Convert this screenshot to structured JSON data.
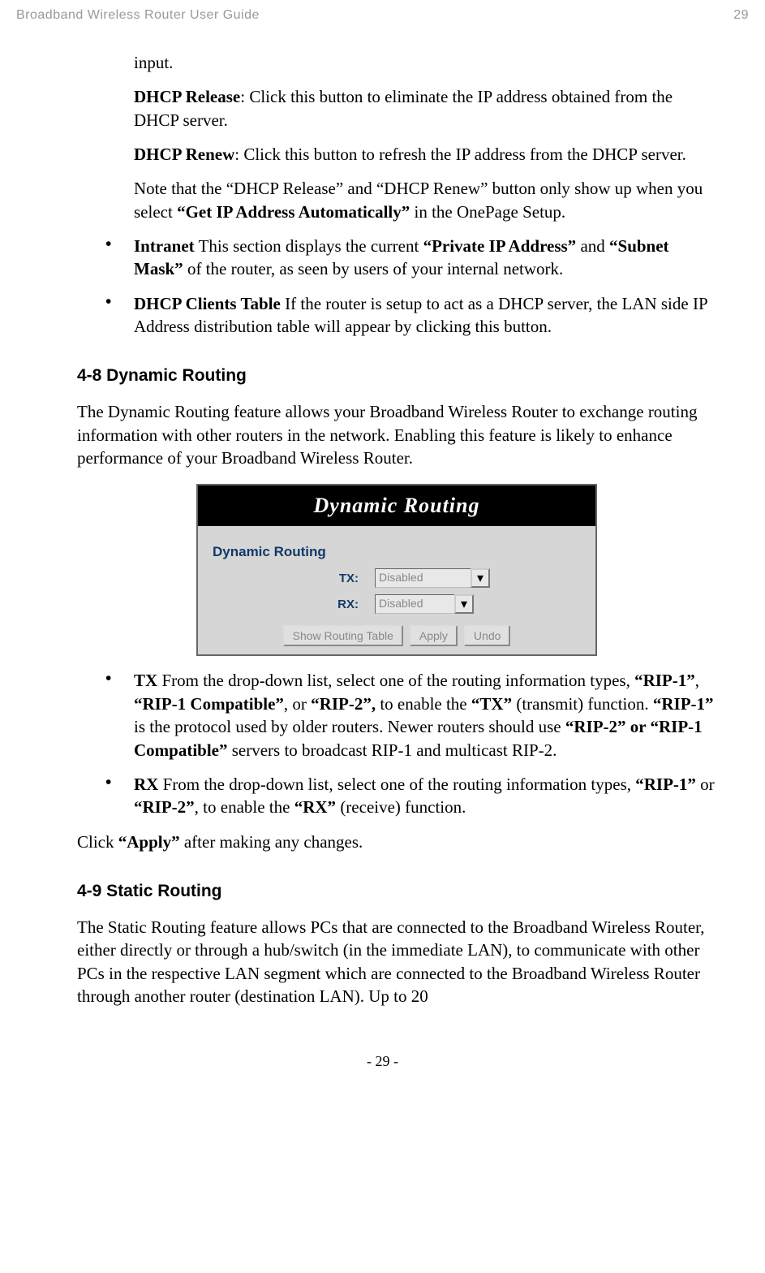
{
  "header": {
    "title": "Broadband Wireless Router User Guide",
    "page_number": "29"
  },
  "body": {
    "input_trail": "input.",
    "dhcp_release_label": "DHCP Release",
    "dhcp_release_text": ": Click this button to eliminate the IP address obtained from the DHCP server.",
    "dhcp_renew_label": "DHCP Renew",
    "dhcp_renew_text": ": Click this button to refresh the IP address from the DHCP server.",
    "note_pre": "Note that the “DHCP Release” and “DHCP Renew” button only show up when you select ",
    "note_bold": "“Get IP Address Automatically”",
    "note_post": " in the OnePage Setup.",
    "intranet_label": "Intranet",
    "intranet_text_pre": " This section displays the current ",
    "intranet_bold1": "“Private IP Address”",
    "intranet_mid": " and ",
    "intranet_bold2": "“Subnet Mask”",
    "intranet_post": " of the router, as seen by users of your internal network.",
    "dhcp_clients_label": "DHCP Clients Table",
    "dhcp_clients_text": " If the router is setup to act as a DHCP server, the LAN side IP Address distribution table will appear by clicking this button.",
    "sec48_heading": "4-8 Dynamic Routing",
    "sec48_intro": "The Dynamic Routing feature allows your Broadband Wireless Router to exchange routing information with other routers in the network. Enabling this feature is likely to enhance performance of your Broadband Wireless Router.",
    "figure": {
      "title": "Dynamic Routing",
      "heading": "Dynamic Routing",
      "tx_label": "TX:",
      "rx_label": "RX:",
      "tx_value": "Disabled",
      "rx_value": "Disabled",
      "btn_show": "Show Routing Table",
      "btn_apply": "Apply",
      "btn_undo": "Undo"
    },
    "tx_label": "TX",
    "tx_pre": " From the drop-down list, select one of the routing information types, ",
    "tx_b1": "“RIP-1”",
    "tx_c1": ", ",
    "tx_b2": "“RIP-1 Compatible”",
    "tx_c2": ", or ",
    "tx_b3": "“RIP-2”,",
    "tx_mid1": " to enable the ",
    "tx_b4": "“TX”",
    "tx_mid2": " (transmit) function. ",
    "tx_b5": "“RIP-1”",
    "tx_mid3": " is the protocol used by older routers. Newer routers should use ",
    "tx_b6": "“RIP-2” or “RIP-1 Compatible”",
    "tx_post": " servers to broadcast RIP-1 and multicast RIP-2.",
    "rx_label": "RX",
    "rx_pre": " From the drop-down list, select one of the routing information types, ",
    "rx_b1": "“RIP-1”",
    "rx_mid1": " or ",
    "rx_b2": "“RIP-2”",
    "rx_mid2": ", to enable the ",
    "rx_b3": "“RX”",
    "rx_post": " (receive) function.",
    "apply_pre": "Click ",
    "apply_bold": "“Apply”",
    "apply_post": " after making any changes.",
    "sec49_heading": "4-9 Static Routing",
    "sec49_intro": "The Static Routing feature allows PCs that are connected to the Broadband Wireless Router, either directly or through a hub/switch (in the immediate LAN), to communicate with other PCs in the respective LAN segment which are connected to the Broadband Wireless Router through another router (destination LAN). Up to 20"
  },
  "footer": {
    "page": "- 29 -"
  }
}
